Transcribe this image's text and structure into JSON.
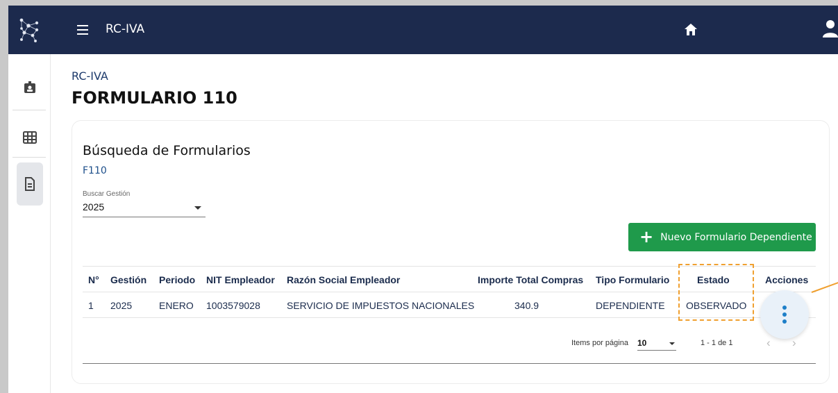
{
  "header": {
    "app_title": "RC-IVA",
    "logo_icon": "network-logo-icon",
    "menu_icon": "hamburger-menu-icon",
    "home_icon": "home-icon",
    "user_icon": "user-icon",
    "bg_color": "#1c2a4d"
  },
  "sidebar": {
    "items": [
      {
        "icon": "id-badge-icon",
        "active": false
      },
      {
        "icon": "table-grid-icon",
        "active": false
      },
      {
        "icon": "document-icon",
        "active": true
      }
    ]
  },
  "breadcrumb": "RC-IVA",
  "page_title": "FORMULARIO 110",
  "card": {
    "title": "Búsqueda de Formularios",
    "subtitle": "F110",
    "gestion_label": "Buscar Gestión",
    "gestion_value": "2025",
    "new_button_label": "Nuevo Formulario Dependiente",
    "new_button_color": "#1f9a4b"
  },
  "table": {
    "headers": [
      "N°",
      "Gestión",
      "Periodo",
      "NIT Empleador",
      "Razón Social Empleador",
      "Importe Total Compras",
      "Tipo Formulario",
      "Estado",
      "Acciones"
    ],
    "rows": [
      [
        "1",
        "2025",
        "ENERO",
        "1003579028",
        "SERVICIO DE IMPUESTOS NACIONALES",
        "340.9",
        "DEPENDIENTE",
        "OBSERVADO"
      ]
    ],
    "actions_icon": "more-vertical-icon"
  },
  "pagination": {
    "items_label": "Items por página",
    "items_value": "10",
    "range": "1 - 1 de 1",
    "prev_icon": "chevron-left-icon",
    "next_icon": "chevron-right-icon"
  },
  "annotation_color": "#f0a030"
}
